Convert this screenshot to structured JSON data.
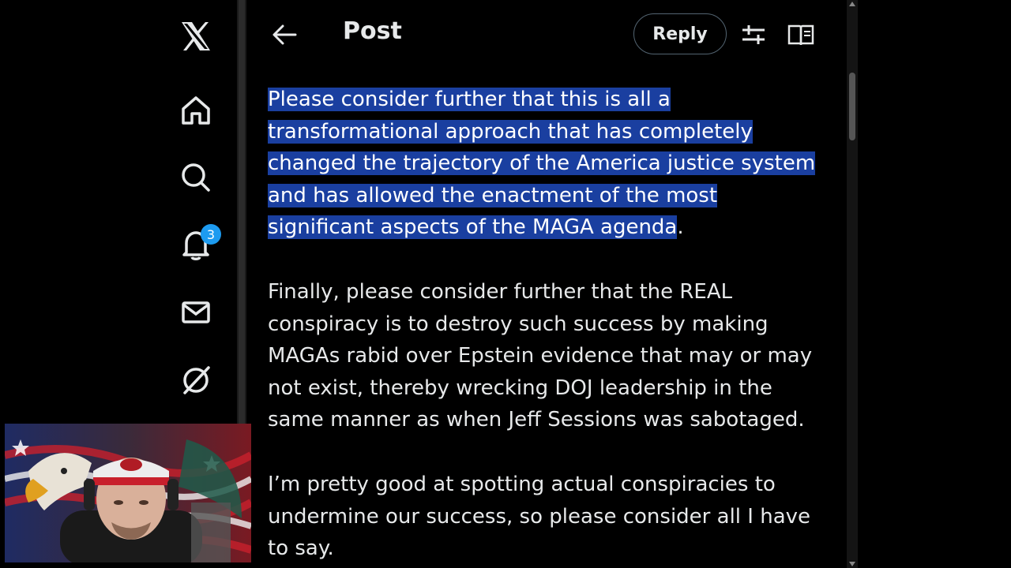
{
  "header": {
    "title": "Post",
    "reply_label": "Reply"
  },
  "sidebar": {
    "items": [
      {
        "icon": "x-logo-icon"
      },
      {
        "icon": "home-icon"
      },
      {
        "icon": "search-icon"
      },
      {
        "icon": "bell-icon",
        "badge": "3"
      },
      {
        "icon": "mail-icon"
      },
      {
        "icon": "grok-icon"
      }
    ]
  },
  "post": {
    "paragraph1_selected": "Please consider further that this is all a transformational approach that has completely changed the trajectory of the America justice system and has allowed the enactment of the most significant aspects of the MAGA agenda",
    "paragraph1_tail": ".",
    "paragraph2": "Finally, please consider further that the REAL conspiracy is to destroy such success by making MAGAs rabid over Epstein evidence that may or may not exist, thereby wrecking DOJ leadership in the same manner as when Jeff Sessions was sabotaged.",
    "paragraph3": "I’m pretty good at spotting actual conspiracies to undermine our success, so please consider all I have to say."
  },
  "colors": {
    "accent": "#1d9bf0",
    "selection": "#1a3fa0",
    "background": "#000000",
    "text": "#e7e9ea"
  }
}
